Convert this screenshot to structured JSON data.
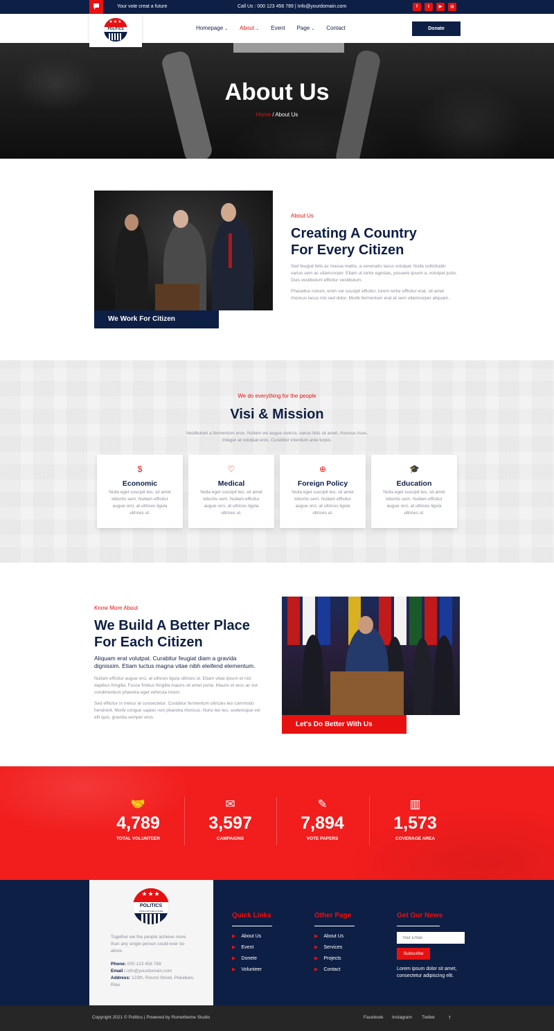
{
  "topbar": {
    "tagline": "Your vote creat a future",
    "contact": "Call Us : 000 123 456 789 | Info@yourdomain.com",
    "socials": [
      {
        "icon": "facebook-icon",
        "glyph": "f"
      },
      {
        "icon": "twitter-icon",
        "glyph": "t"
      },
      {
        "icon": "youtube-icon",
        "glyph": "▶"
      },
      {
        "icon": "instagram-icon",
        "glyph": "◎"
      }
    ]
  },
  "logo": {
    "stars": "★★★",
    "name": "POLITICS",
    "slogan": "VOTE FOR THE FUTURE"
  },
  "nav": {
    "items": [
      {
        "label": "Homepage",
        "chevron": "⌄"
      },
      {
        "label": "About",
        "chevron": "⌄"
      },
      {
        "label": "Event",
        "chevron": ""
      },
      {
        "label": "Page",
        "chevron": "⌄"
      },
      {
        "label": "Contact",
        "chevron": ""
      }
    ],
    "donate": "Donate"
  },
  "hero": {
    "title": "About Us",
    "crumb_home": "Home",
    "crumb_sep": " / ",
    "crumb_current": "About Us"
  },
  "about": {
    "caption": "We Work For Citizen",
    "eyebrow": "About Us",
    "title_line1": "Creating A Country",
    "title_line2": "For Every Citizen",
    "para1": "Sed feugiat felis ac massa mattis, a venenatis lacus volutpat. Nulla sollicitudin varius sem ac ullamcorper. Etiam ut tortor egestas, posuere ipsum a, volutpat justo. Duis vestibulum efficitur vestibulum.",
    "para2": "Phasellus rutrum, enim vel suscipit efficitur, lorem tortor efficitur erat, sit amet rhoncus lacus nisi sed dolor. Morbi fermentum erat at sem ullamcorper aliquam."
  },
  "vision": {
    "eyebrow": "We do everything for the people",
    "title": "Visi & Mission",
    "intro": "Vestibulum a fermentum eros. Nullam vel augue viverra, varius felis sit amet, rhoncus risus. Integer at volutpat eros. Curabitur interdum ante turpis.",
    "cards": [
      {
        "icon": "money-hand-icon",
        "glyph": "$",
        "title": "Economic",
        "text": "Nulla eget suscipit leo, sit amet lobortis sem. Nullam efficitur augue orci, at ultrices ligula ultrices ut."
      },
      {
        "icon": "heartbeat-icon",
        "glyph": "♡",
        "title": "Medical",
        "text": "Nulla eget suscipit leo, sit amet lobortis sem. Nullam efficitur augue orci, at ultrices ligula ultrices ut."
      },
      {
        "icon": "globe-icon",
        "glyph": "⊕",
        "title": "Foreign Policy",
        "text": "Nulla eget suscipit leo, sit amet lobortis sem. Nullam efficitur augue orci, at ultrices ligula ultrices ut."
      },
      {
        "icon": "graduation-cap-icon",
        "glyph": "🎓",
        "title": "Education",
        "text": "Nulla eget suscipit leo, sit amet lobortis sem. Nullam efficitur augue orci, at ultrices ligula ultrices ut."
      }
    ]
  },
  "build": {
    "eyebrow": "Know More About",
    "title_line1": "We Build A Better Place",
    "title_line2": "For Each Citizen",
    "lead": "Aliquam erat volutpat. Curabitur feugiat diam a gravida dignissim. Etiam luctus magna vitae nibh eleifend elementum.",
    "para1": "Nullam efficitur augue orci, at ultrices ligula ultrices ut. Etiam vitae ipsum et nisl dapibus fringilla. Fusce finibus fringilla mauris sit amet porta. Mauris et arcu ac est condimentum pharetra eget vehicula lorem.",
    "para2": "Sed efficitur in metus at consectetur. Curabitur fermentum ultricies leo commodo hendrerit. Morbi congue sapien non pharetra rhoncus. Nunc leo leo, scelerisque vel elit quis, gravida semper eros.",
    "caption": "Let's Do Better With Us"
  },
  "stats": [
    {
      "icon": "handshake-icon",
      "glyph": "🤝",
      "value": "4,789",
      "label": "TOTAL VOLUNTEER"
    },
    {
      "icon": "envelope-icon",
      "glyph": "✉",
      "value": "3,597",
      "label": "CAMPAIGNS"
    },
    {
      "icon": "paper-pen-icon",
      "glyph": "✎",
      "value": "7,894",
      "label": "VOTE PAPERS"
    },
    {
      "icon": "buildings-icon",
      "glyph": "▥",
      "value": "1,573",
      "label": "COVERAGE AREA"
    }
  ],
  "footer": {
    "about_text": "Together we the people achieve more than any single person could ever do alone.",
    "phone_label": "Phone:",
    "phone": " 000 123 456 789",
    "email_label": "Email :",
    "email": " info@yourdomain.com",
    "address_label": "Address:",
    "address": " 123th, Round Street, Pekabaru Riau",
    "quick_title": "Quick Links",
    "quick_links": [
      "About Us",
      "Event",
      "Donete",
      "Volunteer"
    ],
    "other_title": "Other Page",
    "other_links": [
      "About Us",
      "Services",
      "Projects",
      "Contact"
    ],
    "news_title": "Get Our News",
    "email_placeholder": "Your Email",
    "subscribe": "Subscribe",
    "news_text": "Lorem ipsum dolor sit amet, consectetur adipiscing elit."
  },
  "bottom": {
    "copyright": "Copyright 2021 © Politics | Powered by Rometheme Studio",
    "links": [
      "Facebook",
      "Instagram",
      "Twitter"
    ],
    "up": "↑"
  },
  "colors": {
    "navy": "#0e1f45",
    "red": "#e81111",
    "stats_red": "#f21d1d"
  }
}
